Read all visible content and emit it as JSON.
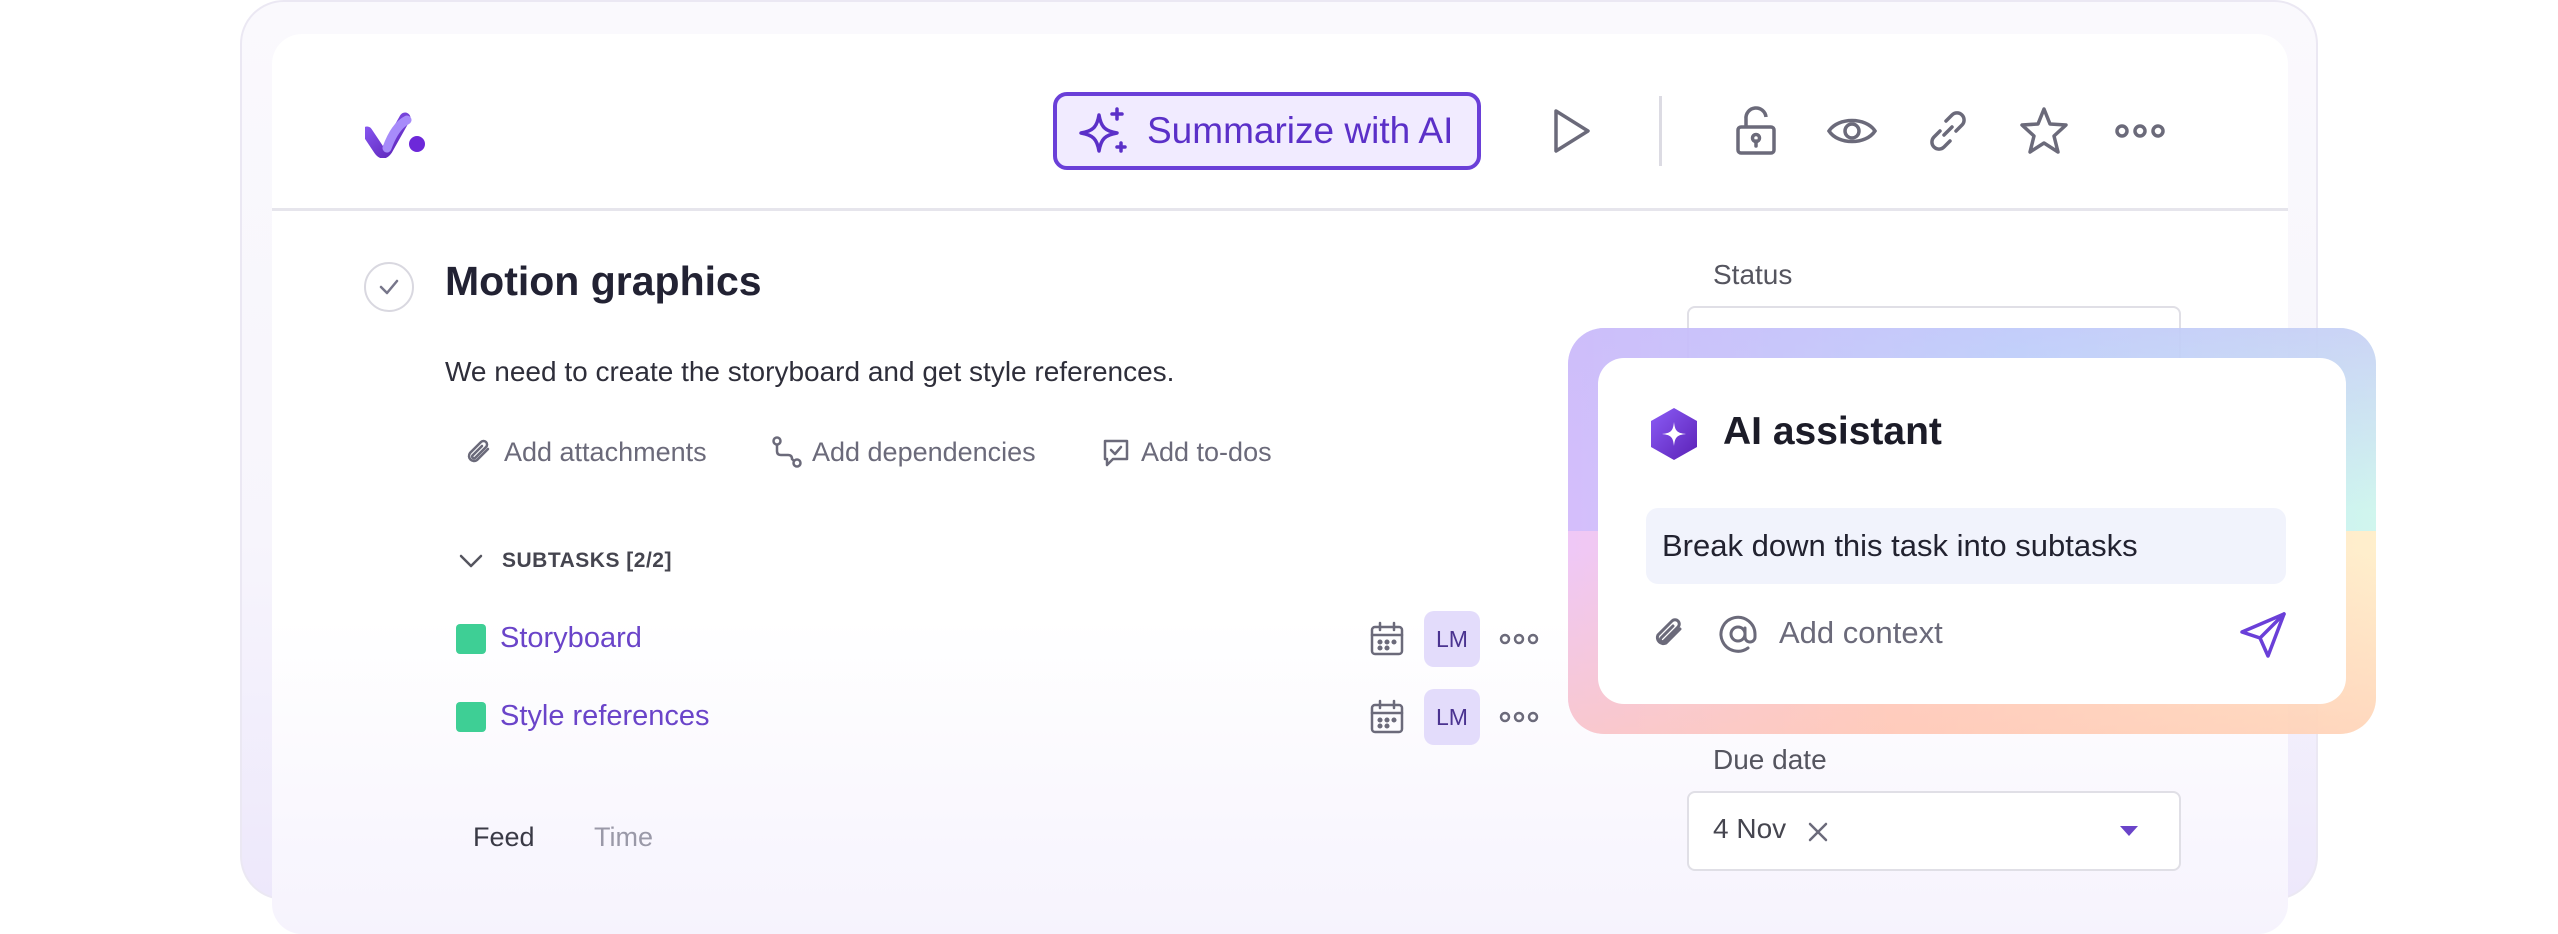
{
  "toolbar": {
    "summarize_label": "Summarize with AI",
    "icons": [
      "play-icon",
      "unlock-icon",
      "eye-icon",
      "link-icon",
      "star-icon",
      "more-icon"
    ]
  },
  "task": {
    "title": "Motion graphics",
    "description": "We need to create the storyboard and get style references.",
    "actions": {
      "attachments": "Add attachments",
      "dependencies": "Add dependencies",
      "todos": "Add to-dos"
    },
    "subtasks_label": "SUBTASKS [2/2]",
    "subtasks": [
      {
        "name": "Storyboard",
        "assignee": "LM",
        "color": "#3ecf95"
      },
      {
        "name": "Style references",
        "assignee": "LM",
        "color": "#3ecf95"
      }
    ]
  },
  "tabs": {
    "feed": "Feed",
    "time": "Time"
  },
  "side": {
    "status_label": "Status",
    "due_label": "Due date",
    "due_value": "4 Nov"
  },
  "assistant": {
    "title": "AI assistant",
    "prompt": "Break down this task into subtasks",
    "context_label": "Add context"
  },
  "colors": {
    "accent": "#6a3fd8",
    "accent_bg": "#f1ebff",
    "subtask_link": "#6a44c9",
    "subtask_done": "#3ecf95"
  }
}
